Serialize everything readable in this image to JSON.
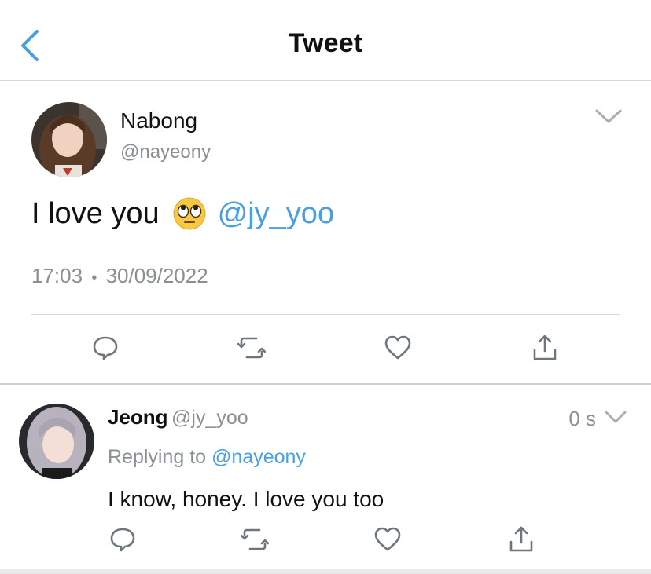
{
  "header": {
    "title": "Tweet",
    "back_icon": "chevron-left-icon",
    "accent": "#4a9fe0"
  },
  "tweet": {
    "author_name": "Nabong",
    "author_handle": "@nayeony",
    "text_prefix": "I love you",
    "emoji": "face-with-rolling-eyes",
    "mention": "@jy_yoo",
    "time": "17:03",
    "separator": "•",
    "date": "30/09/2022",
    "actions": [
      "reply-icon",
      "retweet-icon",
      "like-icon",
      "share-icon"
    ]
  },
  "reply": {
    "author_name": "Jeong",
    "author_handle": "@jy_yoo",
    "time": "0 s",
    "replying_prefix": "Replying to",
    "replying_handle": "@nayeony",
    "text": "I know, honey. I love you too",
    "actions": [
      "reply-icon",
      "retweet-icon",
      "like-icon",
      "share-icon"
    ]
  },
  "colors": {
    "link": "#4a9fe0",
    "muted": "#8a8f94",
    "divider": "#d8d8d8"
  }
}
